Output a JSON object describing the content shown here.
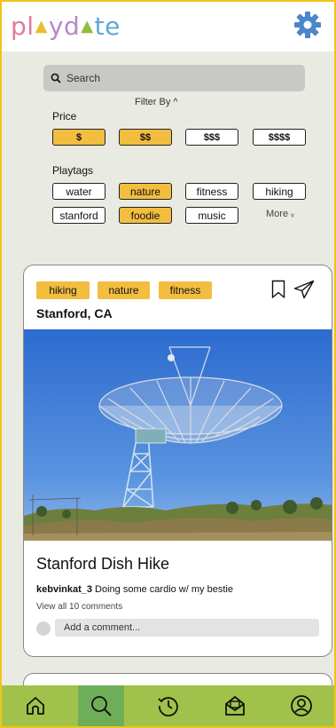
{
  "app": {
    "logo_letters": [
      "pl",
      "▲",
      "yd",
      "▲",
      "te"
    ]
  },
  "colors": {
    "brand_yellow": "#f3bd40",
    "nav_green": "#a1c24a",
    "nav_active": "#6fae58",
    "background": "#e9ebe2"
  },
  "search": {
    "placeholder": "Search",
    "icon": "search-icon"
  },
  "filters": {
    "toggle_label": "Filter By ^",
    "price_label": "Price",
    "prices": [
      {
        "label": "$",
        "selected": true
      },
      {
        "label": "$$",
        "selected": true
      },
      {
        "label": "$$$",
        "selected": false
      },
      {
        "label": "$$$$",
        "selected": false
      }
    ],
    "playtags_label": "Playtags",
    "playtags": [
      {
        "label": "water",
        "selected": false
      },
      {
        "label": "nature",
        "selected": true
      },
      {
        "label": "fitness",
        "selected": false
      },
      {
        "label": "hiking",
        "selected": false
      },
      {
        "label": "stanford",
        "selected": false
      },
      {
        "label": "foodie",
        "selected": true
      },
      {
        "label": "music",
        "selected": false
      }
    ],
    "more_label": "More ᵥ"
  },
  "post": {
    "tags": [
      "hiking",
      "nature",
      "fitness"
    ],
    "location": "Stanford, CA",
    "title": "Stanford Dish Hike",
    "author": "kebvinkat_3",
    "caption": " Doing some cardio w/ my bestie",
    "view_comments": "View all 10 comments",
    "comment_placeholder": "Add a comment..."
  },
  "nav": {
    "items": [
      {
        "name": "home",
        "icon": "home-icon",
        "active": false
      },
      {
        "name": "search",
        "icon": "search-icon",
        "active": true
      },
      {
        "name": "history",
        "icon": "history-icon",
        "active": false
      },
      {
        "name": "inbox",
        "icon": "mail-icon",
        "active": false
      },
      {
        "name": "profile",
        "icon": "profile-icon",
        "active": false
      }
    ]
  }
}
